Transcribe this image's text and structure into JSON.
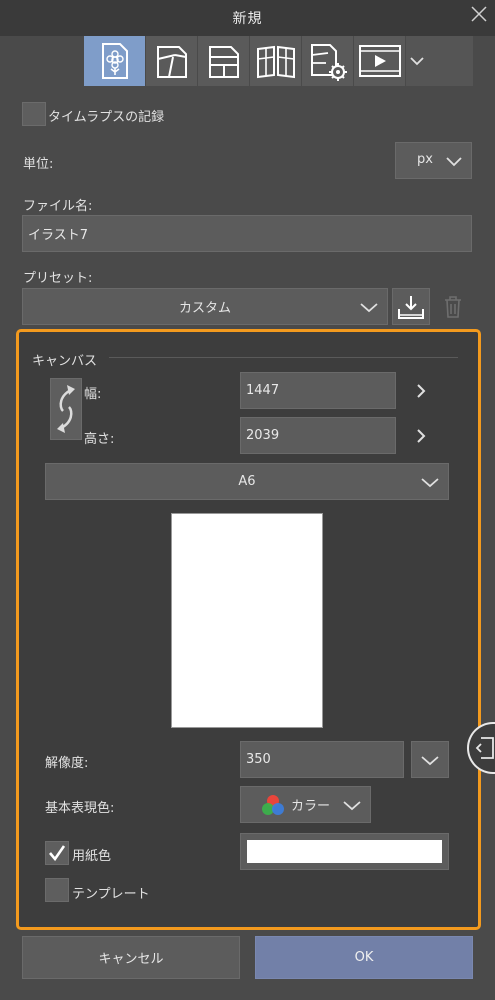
{
  "window": {
    "title": "新規"
  },
  "icon_strip": [
    {
      "icon": "illustration-icon",
      "active": true
    },
    {
      "icon": "comic-page-icon"
    },
    {
      "icon": "comic-spread-icon"
    },
    {
      "icon": "book-icon"
    },
    {
      "icon": "page-settings-icon"
    },
    {
      "icon": "animation-icon"
    },
    {
      "icon": "chevron-down-icon"
    }
  ],
  "timelapse": {
    "label": "タイムラプスの記録",
    "checked": false
  },
  "unit": {
    "label": "単位:",
    "value": "px"
  },
  "filename": {
    "label": "ファイル名:",
    "value": "イラスト7"
  },
  "preset": {
    "label": "プリセット:",
    "value": "カスタム"
  },
  "canvas": {
    "heading": "キャンバス",
    "width_label": "幅:",
    "width_value": "1447",
    "height_label": "高さ:",
    "height_value": "2039",
    "size_preset": "A6"
  },
  "resolution": {
    "label": "解像度:",
    "value": "350"
  },
  "color_mode": {
    "label": "基本表現色:",
    "value": "カラー"
  },
  "paper_color": {
    "label": "用紙色",
    "checked": true,
    "swatch": "#ffffff"
  },
  "template": {
    "label": "テンプレート",
    "checked": false
  },
  "buttons": {
    "cancel": "キャンセル",
    "ok": "OK"
  },
  "colors": {
    "accent_orange": "#f39a1e",
    "ok_blue": "#7280a8",
    "active_icon": "#7f9dc9"
  }
}
